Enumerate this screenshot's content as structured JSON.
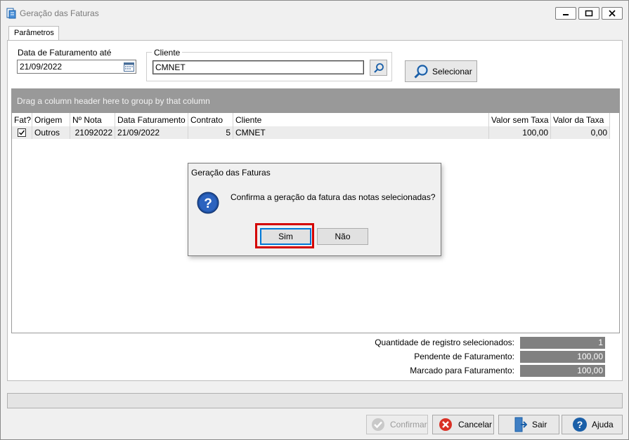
{
  "window": {
    "title": "Geração das Faturas"
  },
  "tabs": [
    {
      "label": "Parâmetros"
    }
  ],
  "params": {
    "date_label": "Data de Faturamento até",
    "date_value": "21/09/2022",
    "client_group_label": "Cliente",
    "client_value": "CMNET",
    "select_button": "Selecionar"
  },
  "grid": {
    "group_hint": "Drag a column header here to group by that column",
    "columns": [
      "Fat?",
      "Origem",
      "Nº Nota",
      "Data Faturamento",
      "Contrato",
      "Cliente",
      "Valor sem Taxa",
      "Valor da Taxa"
    ],
    "rows": [
      {
        "fat": true,
        "origem": "Outros",
        "nota": "21092022",
        "data": "21/09/2022",
        "contrato": "5",
        "cliente": "CMNET",
        "valor_sem_taxa": "100,00",
        "valor_taxa": "0,00"
      }
    ]
  },
  "summary": {
    "qtd_label": "Quantidade de registro selecionados:",
    "qtd_value": "1",
    "pendente_label": "Pendente de Faturamento:",
    "pendente_value": "100,00",
    "marcado_label": "Marcado para Faturamento:",
    "marcado_value": "100,00"
  },
  "footer": {
    "confirmar": "Confirmar",
    "cancelar": "Cancelar",
    "sair": "Sair",
    "ajuda": "Ajuda"
  },
  "dialog": {
    "title": "Geração das Faturas",
    "message": "Confirma a geração da fatura das notas selecionadas?",
    "yes": "Sim",
    "no": "Não"
  },
  "colors": {
    "accent": "#1a5fa8",
    "highlight": "#d40000",
    "cancel": "#d93025"
  }
}
